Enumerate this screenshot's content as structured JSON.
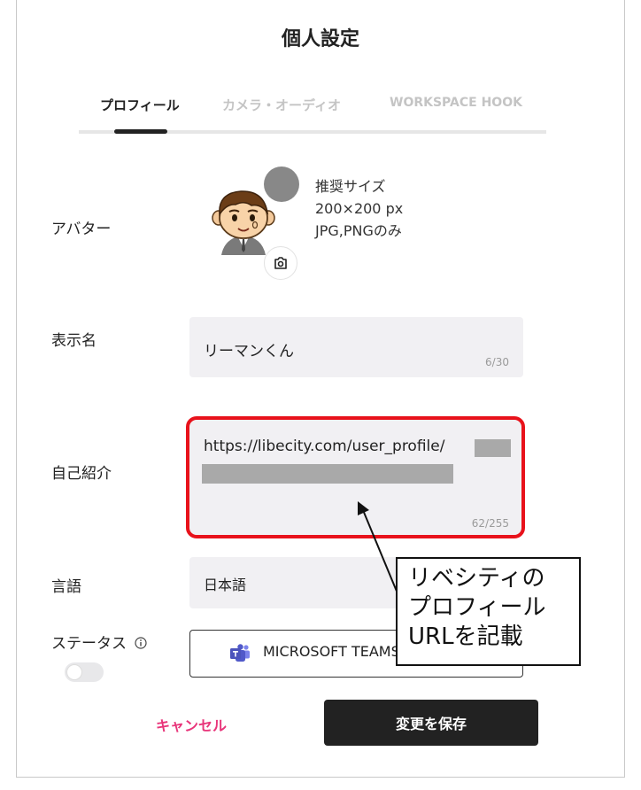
{
  "title": "個人設定",
  "tabs": [
    {
      "label": "プロフィール",
      "active": true
    },
    {
      "label": "カメラ・オーディオ",
      "active": false
    },
    {
      "label": "WORKSPACE HOOK",
      "active": false
    }
  ],
  "avatar": {
    "label": "アバター",
    "info_line1": "推奨サイズ",
    "info_line2": "200×200 px",
    "info_line3": "JPG,PNGのみ"
  },
  "display_name": {
    "label": "表示名",
    "value": "リーマンくん",
    "counter": "6/30"
  },
  "bio": {
    "label": "自己紹介",
    "value": "https://libecity.com/user_profile/",
    "counter": "62/255"
  },
  "language": {
    "label": "言語",
    "value": "日本語"
  },
  "status": {
    "label": "ステータス",
    "button_text": "MICROSOFT TEAMS",
    "toggle_on": false
  },
  "actions": {
    "cancel_label": "キャンセル",
    "save_label": "変更を保存"
  },
  "annotation": {
    "line1": "リベシティの",
    "line2": "プロフィール",
    "line3": "URLを記載"
  },
  "colors": {
    "highlight": "#e8121b",
    "cancel": "#e8357a",
    "primary": "#222222"
  }
}
